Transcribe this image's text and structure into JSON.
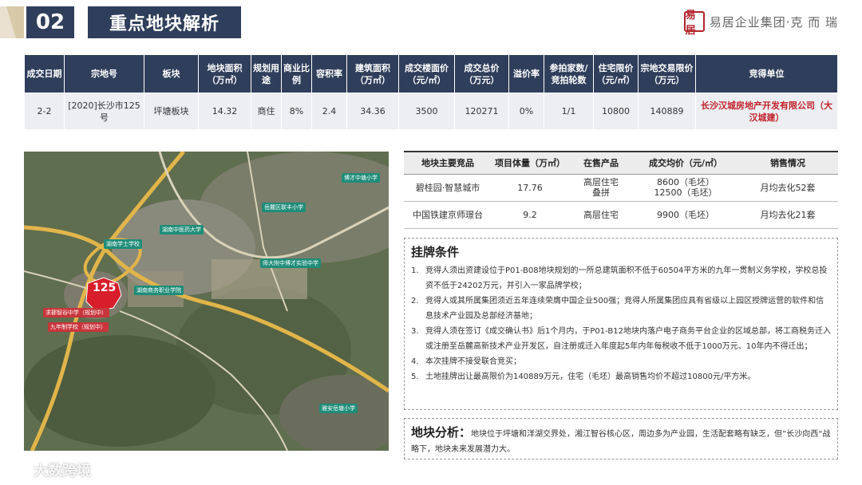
{
  "header": {
    "number": "02",
    "title": "重点地块解析"
  },
  "logo": {
    "mark": "易居",
    "text": "易居企业集团·克 而 瑞"
  },
  "deal_table": {
    "headers": [
      "成交日期",
      "宗地号",
      "板块",
      "地块面积（万㎡）",
      "规划用途",
      "商业比例",
      "容积率",
      "建筑面积（万㎡）",
      "成交楼面价（元/㎡）",
      "成交总价（万元）",
      "溢价率",
      "参拍家数/竞拍轮数",
      "住宅限价（元/㎡）",
      "宗地交易限价（万元）",
      "竞得单位"
    ],
    "row": [
      "2-2",
      "[2020]长沙市125号",
      "坪塘板块",
      "14.32",
      "商住",
      "8%",
      "2.4",
      "34.36",
      "3500",
      "120271",
      "0%",
      "1/1",
      "10800",
      "140889",
      "长沙汉城房地产开发有限公司（大汉城建）"
    ]
  },
  "map": {
    "plot_label": "125",
    "labels": [
      "博才中塘小学",
      "岳麓区联丰小学",
      "湖南中医药大学",
      "湖南学士学校",
      "师大附中博才实验中学",
      "湖南商务职业学院",
      "求郡智谷中学（规划中）",
      "九年制学校（规划中）",
      "雅安岳塘小学"
    ]
  },
  "competitors": {
    "headers": [
      "地块主要竞品",
      "项目体量（万㎡）",
      "在售产品",
      "成交均价（元/㎡）",
      "销售情况"
    ],
    "rows": [
      [
        "碧桂园·智慧城市",
        "17.76",
        "高层住宅\n叠拼",
        "8600（毛坯）\n12500（毛坯）",
        "月均去化52套"
      ],
      [
        "中国铁建京师璟台",
        "9.2",
        "高层住宅",
        "9900（毛坯）",
        "月均去化21套"
      ]
    ]
  },
  "conditions": {
    "title": "挂牌条件",
    "items": [
      "竞得人须出资建设位于P01-B08地块规划的一所总建筑面积不低于60504平方米的九年一贯制义务学校，学校总投资不低于24202万元，并引入一家品牌学校；",
      "竞得人或其所属集团须近五年连续荣膺中国企业500强；竞得人所属集团应具有省级以上园区授牌运营的软件和信息技术产业园及总部经济基地；",
      "竞得人须在签订《成交确认书》后1个月内，于P01-B12地块内落户电子商务平台企业的区域总部，将工商税务迁入或注册至岳麓高新技术产业开发区，自注册或迁入年度起5年内年每税收不低于1000万元、10年内不得迁出；",
      "本次挂牌不接受联合竞买；",
      "土地挂牌出让最高限价为140889万元，住宅（毛坯）最高销售均价不超过10800元/平方米。"
    ]
  },
  "analysis": {
    "title": "地块分析：",
    "text": "地块位于坪塘和洋湖交界处，湘江智谷核心区，周边多为产业园，生活配套略有缺乏，但”长沙向西“战略下，地块未来发展潜力大。"
  },
  "watermark": {
    "text": "大数跨境"
  }
}
